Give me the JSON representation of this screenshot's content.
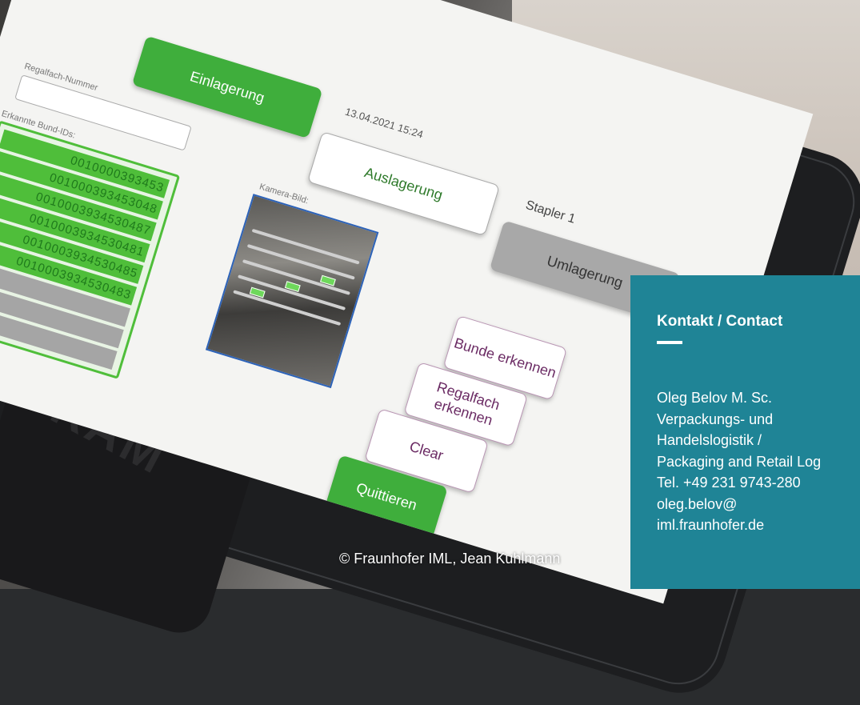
{
  "tablet_ui": {
    "btn_einlagerung": "Einlagerung",
    "lbl_regalfach": "Regalfach-Nummer",
    "lbl_bund_ids": "Erkannte Bund-IDs:",
    "date": "13.04.2021 15:24",
    "btn_auslagerung": "Auslagerung",
    "stapler": "Stapler 1",
    "btn_umlagerung": "Umlagerung",
    "lbl_kamera": "Kamera-Bild:",
    "bund_ids": [
      "0010000393453",
      "001000393453048",
      "0010003934530487",
      "0010003934530481",
      "0010003934530485",
      "0010003934530483"
    ],
    "btn_bunde": "Bunde erkennen",
    "btn_regalfach": "Regalfach erkennen",
    "btn_clear": "Clear",
    "btn_quittieren": "Quittieren",
    "gear_icon": "gear-icon",
    "mount_logo": "RAM"
  },
  "overlay": {
    "title": "Kontakt / Contact",
    "lines": [
      "Oleg Belov M. Sc.",
      "Verpackungs- und",
      "Handelslogistik /",
      "Packaging and Retail Log",
      "Tel. +49 231 9743-280",
      "oleg.belov@",
      "iml.fraunhofer.de"
    ],
    "background_color": "#1f8496"
  },
  "credit": "© Fraunhofer IML, Jean Kuhlmann"
}
